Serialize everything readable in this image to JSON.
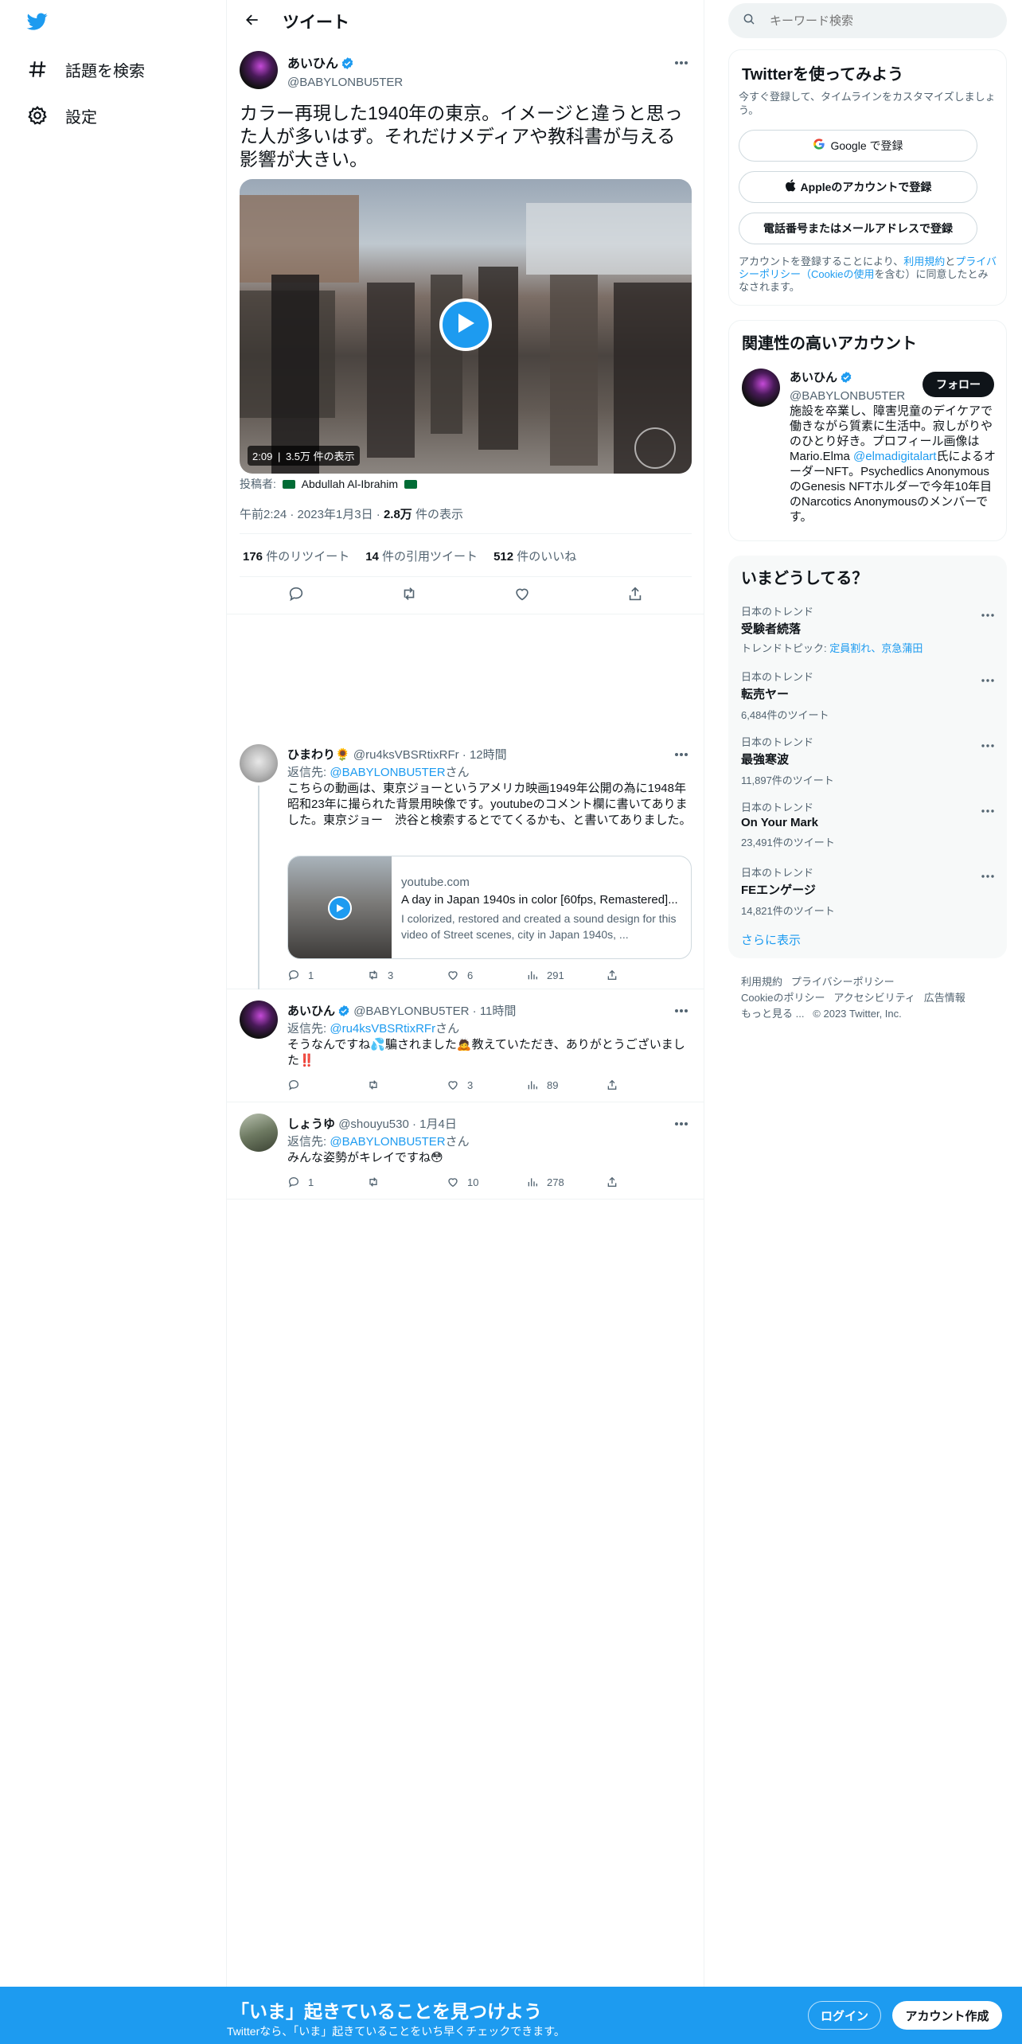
{
  "nav": {
    "items": [
      {
        "label": "話題を検索",
        "icon": "hashtag-icon"
      },
      {
        "label": "設定",
        "icon": "gear-icon"
      }
    ]
  },
  "header": {
    "title": "ツイート"
  },
  "tweet": {
    "author_name": "あいひん",
    "author_handle": "@BABYLONBU5TER",
    "text": "カラー再現した1940年の東京。イメージと違うと思った人が多いはず。それだけメディアや教科書が与える影響が大きい。",
    "video": {
      "duration": "2:09",
      "views": "3.5万 件の表示"
    },
    "poster_prefix": "投稿者: ",
    "poster_name": "Abdullah Al-Ibrahim",
    "time": "午前2:24",
    "date": "2023年1月3日",
    "view_count": "2.8万",
    "view_suffix": " 件の表示",
    "retweets": "176",
    "retweets_label": " 件のリツイート",
    "quotes": "14",
    "quotes_label": " 件の引用ツイート",
    "likes": "512",
    "likes_label": " 件のいいね"
  },
  "replies": [
    {
      "name": "ひまわり",
      "handle": "@ru4ksVBSRtixRFr",
      "time": "12時間",
      "reply_to_prefix": "返信先: ",
      "reply_to": "@BABYLONBU5TER",
      "reply_to_suffix": "さん",
      "text": "こちらの動画は、東京ジョーというアメリカ映画1949年公開の為に1948年昭和23年に撮られた背景用映像です。youtubeのコメント欄に書いてありました。東京ジョー　渋谷と検索するとでてくるかも、と書いてありました。",
      "card": {
        "domain": "youtube.com",
        "title": "A day in Japan 1940s in color [60fps, Remastered]...",
        "desc": "I colorized, restored and created a sound design for this video of Street scenes, city in Japan 1940s, ..."
      },
      "replies": "1",
      "retweets": "3",
      "likes": "6",
      "views": "291"
    },
    {
      "name": "あいひん",
      "handle": "@BABYLONBU5TER",
      "time": "11時間",
      "reply_to_prefix": "返信先: ",
      "reply_to": "@ru4ksVBSRtixRFr",
      "reply_to_suffix": "さん",
      "text": "そうなんですね💦騙されました🙇教えていただき、ありがとうございました‼️",
      "replies": "",
      "retweets": "",
      "likes": "3",
      "views": "89"
    },
    {
      "name": "しょうゆ",
      "handle": "@shouyu530",
      "time": "1月4日",
      "reply_to_prefix": "返信先: ",
      "reply_to": "@BABYLONBU5TER",
      "reply_to_suffix": "さん",
      "text": "みんな姿勢がキレイですね😳",
      "replies": "1",
      "retweets": "",
      "likes": "10",
      "views": "278"
    }
  ],
  "search": {
    "placeholder": "キーワード検索"
  },
  "signup": {
    "title": "Twitterを使ってみよう",
    "subtitle": "今すぐ登録して、タイムラインをカスタマイズしましょう。",
    "google_btn": "Google で登録",
    "apple_btn": "Appleのアカウントで登録",
    "phone_btn": "電話番号またはメールアドレスで登録",
    "legal_1": "アカウントを登録することにより、",
    "legal_terms": "利用規約",
    "legal_2": "と",
    "legal_privacy": "プライバシーポリシー（Cookieの使用",
    "legal_3": "を含む）に同意したとみなされます。"
  },
  "relevant": {
    "title": "関連性の高いアカウント",
    "name": "あいひん",
    "handle": "@BABYLONBU5TER",
    "follow": "フォロー",
    "bio_1": "施設を卒業し、障害児童のデイケアで働きながら質素に生活中。寂しがりやのひとり好き。プロフィール画像はMario.Elma ",
    "bio_link": "@elmadigitalart",
    "bio_2": "氏によるオーダーNFT。Psychedlics AnonymousのGenesis NFTホルダーで今年10年目のNarcotics Anonymousのメンバーです。"
  },
  "trends": {
    "title": "いまどうしてる？",
    "items": [
      {
        "category": "日本のトレンド",
        "name": "受験者続落",
        "topic_prefix": "トレンドトピック: ",
        "topic": "定員割れ、京急蒲田"
      },
      {
        "category": "日本のトレンド",
        "name": "転売ヤー",
        "count": "6,484件のツイート"
      },
      {
        "category": "日本のトレンド",
        "name": "最強寒波",
        "count": "11,897件のツイート"
      },
      {
        "category": "日本のトレンド",
        "name": "On Your Mark",
        "count": "23,491件のツイート"
      },
      {
        "category": "日本のトレンド",
        "name": "FEエンゲージ",
        "count": "14,821件のツイート"
      }
    ],
    "show_more": "さらに表示"
  },
  "footer": {
    "links": [
      "利用規約",
      "プライバシーポリシー",
      "Cookieのポリシー",
      "アクセシビリティ",
      "広告情報",
      "もっと見る ..."
    ],
    "copyright": "© 2023 Twitter, Inc."
  },
  "bottom_bar": {
    "headline": "「いま」起きていることを見つけよう",
    "sub": "Twitterなら、「いま」起きていることをいち早くチェックできます。",
    "login": "ログイン",
    "signup": "アカウント作成"
  },
  "colors": {
    "accent": "#1d9bf0",
    "text": "#0f1419",
    "muted": "#536471"
  }
}
